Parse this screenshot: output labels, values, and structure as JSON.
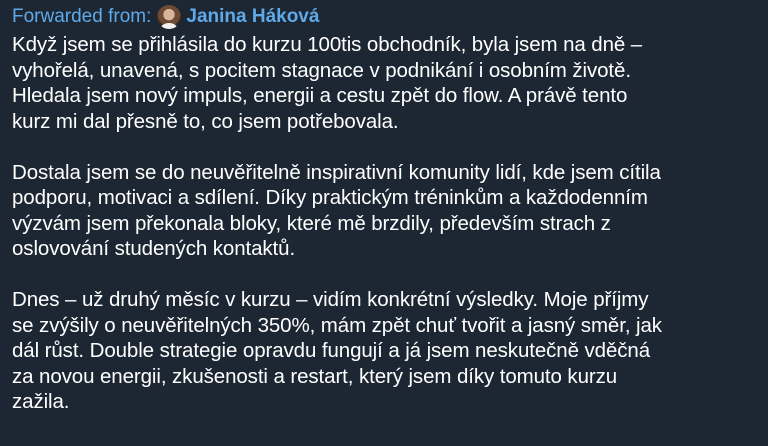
{
  "forward": {
    "label": "Forwarded from:",
    "sender_name": "Janina Háková",
    "avatar_icon": "profile-photo"
  },
  "message": {
    "paragraphs": [
      {
        "lines": [
          "Když jsem se přihlásila do kurzu 100tis obchodník, byla jsem na dně –",
          "vyhořelá, unavená, s pocitem stagnace v podnikání i osobním životě.",
          "Hledala jsem nový impuls, energii a cestu zpět do flow. A právě tento",
          "kurz mi dal přesně to, co jsem potřebovala."
        ]
      },
      {
        "lines": [
          "Dostala jsem se do neuvěřitelně inspirativní komunity lidí, kde jsem cítila",
          "podporu, motivaci a sdílení. Díky praktickým tréninkům a každodenním",
          "výzvám jsem překonala bloky, které mě brzdily, především strach z",
          "oslovování studených kontaktů."
        ]
      },
      {
        "lines": [
          "Dnes – už druhý měsíc v kurzu – vidím konkrétní výsledky. Moje příjmy",
          "se zvýšily o neuvěřitelných 350%, mám zpět chuť tvořit a jasný směr, jak",
          "dál růst. Double strategie opravdu fungují a já jsem neskutečně vděčná",
          "za novou energii, zkušenosti a restart, který jsem díky tomuto kurzu",
          "zažila."
        ]
      }
    ]
  },
  "colors": {
    "background": "#1c2733",
    "text": "#ffffff",
    "forward_accent": "#5fa9e8"
  }
}
